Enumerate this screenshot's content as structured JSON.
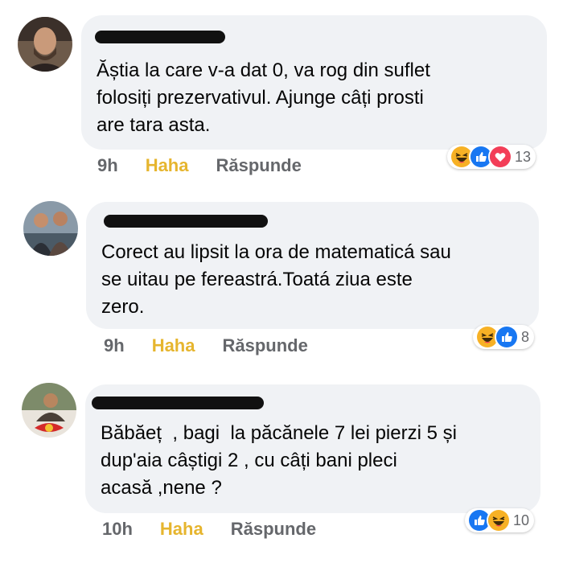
{
  "comments": [
    {
      "text": "Ăștia la care v-a dat 0, va rog din suflet\nfolosiți prezervativul. Ajunge câți prosti\nare tara asta.",
      "time": "9h",
      "haha": "Haha",
      "reply": "Răspunde",
      "reactions": [
        "haha-icon",
        "like-icon",
        "love-icon"
      ],
      "reaction_count": "13"
    },
    {
      "text": "Corect au lipsit la ora de matematicá sau\nse uitau pe fereastrá.Toatá ziua este\nzero.",
      "time": "9h",
      "haha": "Haha",
      "reply": "Răspunde",
      "reactions": [
        "haha-icon",
        "like-icon"
      ],
      "reaction_count": "8"
    },
    {
      "text": "Băbăeț  , bagi  la păcănele 7 lei pierzi 5 și\ndup'aia câștigi 2 , cu câți bani pleci\nacasă ,nene ?",
      "time": "10h",
      "haha": "Haha",
      "reply": "Răspunde",
      "reactions": [
        "like-icon",
        "haha-icon"
      ],
      "reaction_count": "10"
    }
  ],
  "colors": {
    "bubble": "#f0f2f5",
    "meta": "#65676b",
    "haha_active": "#e6b52e",
    "like": "#1877f2",
    "love": "#f33e58",
    "haha_face": "#f7b125"
  }
}
